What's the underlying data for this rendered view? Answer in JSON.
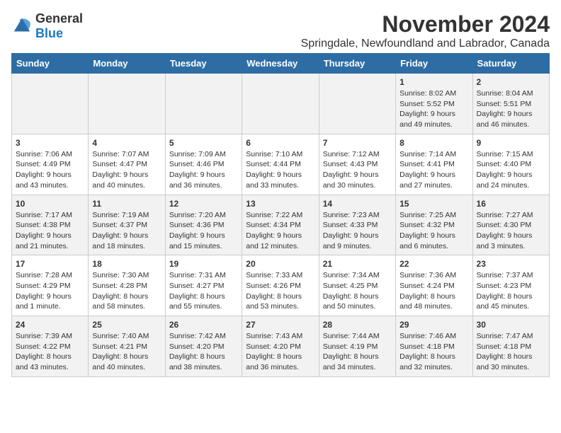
{
  "logo": {
    "general": "General",
    "blue": "Blue"
  },
  "title": {
    "month": "November 2024",
    "location": "Springdale, Newfoundland and Labrador, Canada"
  },
  "headers": [
    "Sunday",
    "Monday",
    "Tuesday",
    "Wednesday",
    "Thursday",
    "Friday",
    "Saturday"
  ],
  "weeks": [
    [
      {
        "day": "",
        "info": ""
      },
      {
        "day": "",
        "info": ""
      },
      {
        "day": "",
        "info": ""
      },
      {
        "day": "",
        "info": ""
      },
      {
        "day": "",
        "info": ""
      },
      {
        "day": "1",
        "info": "Sunrise: 8:02 AM\nSunset: 5:52 PM\nDaylight: 9 hours and 49 minutes."
      },
      {
        "day": "2",
        "info": "Sunrise: 8:04 AM\nSunset: 5:51 PM\nDaylight: 9 hours and 46 minutes."
      }
    ],
    [
      {
        "day": "3",
        "info": "Sunrise: 7:06 AM\nSunset: 4:49 PM\nDaylight: 9 hours and 43 minutes."
      },
      {
        "day": "4",
        "info": "Sunrise: 7:07 AM\nSunset: 4:47 PM\nDaylight: 9 hours and 40 minutes."
      },
      {
        "day": "5",
        "info": "Sunrise: 7:09 AM\nSunset: 4:46 PM\nDaylight: 9 hours and 36 minutes."
      },
      {
        "day": "6",
        "info": "Sunrise: 7:10 AM\nSunset: 4:44 PM\nDaylight: 9 hours and 33 minutes."
      },
      {
        "day": "7",
        "info": "Sunrise: 7:12 AM\nSunset: 4:43 PM\nDaylight: 9 hours and 30 minutes."
      },
      {
        "day": "8",
        "info": "Sunrise: 7:14 AM\nSunset: 4:41 PM\nDaylight: 9 hours and 27 minutes."
      },
      {
        "day": "9",
        "info": "Sunrise: 7:15 AM\nSunset: 4:40 PM\nDaylight: 9 hours and 24 minutes."
      }
    ],
    [
      {
        "day": "10",
        "info": "Sunrise: 7:17 AM\nSunset: 4:38 PM\nDaylight: 9 hours and 21 minutes."
      },
      {
        "day": "11",
        "info": "Sunrise: 7:19 AM\nSunset: 4:37 PM\nDaylight: 9 hours and 18 minutes."
      },
      {
        "day": "12",
        "info": "Sunrise: 7:20 AM\nSunset: 4:36 PM\nDaylight: 9 hours and 15 minutes."
      },
      {
        "day": "13",
        "info": "Sunrise: 7:22 AM\nSunset: 4:34 PM\nDaylight: 9 hours and 12 minutes."
      },
      {
        "day": "14",
        "info": "Sunrise: 7:23 AM\nSunset: 4:33 PM\nDaylight: 9 hours and 9 minutes."
      },
      {
        "day": "15",
        "info": "Sunrise: 7:25 AM\nSunset: 4:32 PM\nDaylight: 9 hours and 6 minutes."
      },
      {
        "day": "16",
        "info": "Sunrise: 7:27 AM\nSunset: 4:30 PM\nDaylight: 9 hours and 3 minutes."
      }
    ],
    [
      {
        "day": "17",
        "info": "Sunrise: 7:28 AM\nSunset: 4:29 PM\nDaylight: 9 hours and 1 minute."
      },
      {
        "day": "18",
        "info": "Sunrise: 7:30 AM\nSunset: 4:28 PM\nDaylight: 8 hours and 58 minutes."
      },
      {
        "day": "19",
        "info": "Sunrise: 7:31 AM\nSunset: 4:27 PM\nDaylight: 8 hours and 55 minutes."
      },
      {
        "day": "20",
        "info": "Sunrise: 7:33 AM\nSunset: 4:26 PM\nDaylight: 8 hours and 53 minutes."
      },
      {
        "day": "21",
        "info": "Sunrise: 7:34 AM\nSunset: 4:25 PM\nDaylight: 8 hours and 50 minutes."
      },
      {
        "day": "22",
        "info": "Sunrise: 7:36 AM\nSunset: 4:24 PM\nDaylight: 8 hours and 48 minutes."
      },
      {
        "day": "23",
        "info": "Sunrise: 7:37 AM\nSunset: 4:23 PM\nDaylight: 8 hours and 45 minutes."
      }
    ],
    [
      {
        "day": "24",
        "info": "Sunrise: 7:39 AM\nSunset: 4:22 PM\nDaylight: 8 hours and 43 minutes."
      },
      {
        "day": "25",
        "info": "Sunrise: 7:40 AM\nSunset: 4:21 PM\nDaylight: 8 hours and 40 minutes."
      },
      {
        "day": "26",
        "info": "Sunrise: 7:42 AM\nSunset: 4:20 PM\nDaylight: 8 hours and 38 minutes."
      },
      {
        "day": "27",
        "info": "Sunrise: 7:43 AM\nSunset: 4:20 PM\nDaylight: 8 hours and 36 minutes."
      },
      {
        "day": "28",
        "info": "Sunrise: 7:44 AM\nSunset: 4:19 PM\nDaylight: 8 hours and 34 minutes."
      },
      {
        "day": "29",
        "info": "Sunrise: 7:46 AM\nSunset: 4:18 PM\nDaylight: 8 hours and 32 minutes."
      },
      {
        "day": "30",
        "info": "Sunrise: 7:47 AM\nSunset: 4:18 PM\nDaylight: 8 hours and 30 minutes."
      }
    ]
  ]
}
